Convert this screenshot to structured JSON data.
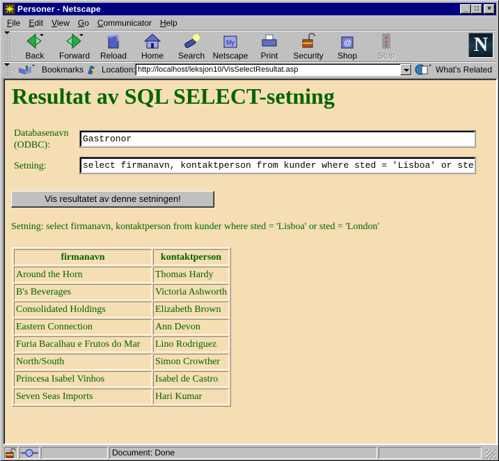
{
  "window": {
    "title": "Personer - Netscape",
    "controls": {
      "minimize": "_",
      "maximize": "□",
      "close": "×"
    }
  },
  "menu": [
    {
      "label": "File",
      "accel": "F"
    },
    {
      "label": "Edit",
      "accel": "E"
    },
    {
      "label": "View",
      "accel": "V"
    },
    {
      "label": "Go",
      "accel": "G"
    },
    {
      "label": "Communicator",
      "accel": "C"
    },
    {
      "label": "Help",
      "accel": "H"
    }
  ],
  "toolbar": {
    "buttons": [
      {
        "label": "Back",
        "icon": "back-arrow-icon",
        "enabled": true
      },
      {
        "label": "Forward",
        "icon": "forward-arrow-icon",
        "enabled": true
      },
      {
        "label": "Reload",
        "icon": "reload-icon",
        "enabled": true
      },
      {
        "label": "Home",
        "icon": "home-icon",
        "enabled": true
      },
      {
        "label": "Search",
        "icon": "search-icon",
        "enabled": true
      },
      {
        "label": "Netscape",
        "icon": "my-netscape-icon",
        "enabled": true
      },
      {
        "label": "Print",
        "icon": "printer-icon",
        "enabled": true
      },
      {
        "label": "Security",
        "icon": "padlock-icon",
        "enabled": true
      },
      {
        "label": "Shop",
        "icon": "shop-bag-icon",
        "enabled": true
      },
      {
        "label": "Stop",
        "icon": "stop-icon",
        "enabled": false
      }
    ],
    "logo": "N"
  },
  "location_bar": {
    "bookmarks_label": "Bookmarks",
    "location_label": "Location:",
    "url": "http://localhost/leksjon10/VisSelectResultat.asp",
    "whats_related_label": "What's Related"
  },
  "page": {
    "heading": "Resultat av SQL SELECT-setning",
    "db_label": "Databasenavn (ODBC):",
    "db_value": "Gastronor",
    "statement_label": "Setning:",
    "statement_value": "select firmanavn, kontaktperson from kunder where sted = 'Lisboa' or sted = 'London'",
    "submit_label": "Vis resultatet av denne setningen!",
    "result_statement": "Setning: select firmanavn, kontaktperson from kunder where sted = 'Lisboa' or sted = 'London'",
    "table": {
      "columns": [
        "firmanavn",
        "kontaktperson"
      ],
      "rows": [
        [
          "Around the Horn",
          "Thomas Hardy"
        ],
        [
          "B's Beverages",
          "Victoria Ashworth"
        ],
        [
          "Consolidated Holdings",
          "Elizabeth Brown"
        ],
        [
          "Eastern Connection",
          "Ann Devon"
        ],
        [
          "Furia Bacalhau e Frutos do Mar",
          "Lino Rodriguez"
        ],
        [
          "North/South",
          "Simon Crowther"
        ],
        [
          "Princesa Isabel Vinhos",
          "Isabel de Castro"
        ],
        [
          "Seven Seas Imports",
          "Hari Kumar"
        ]
      ]
    }
  },
  "status": {
    "text": "Document: Done"
  },
  "colors": {
    "page_background": "#f5deb3",
    "text": "#006400",
    "titlebar": "#000080"
  }
}
